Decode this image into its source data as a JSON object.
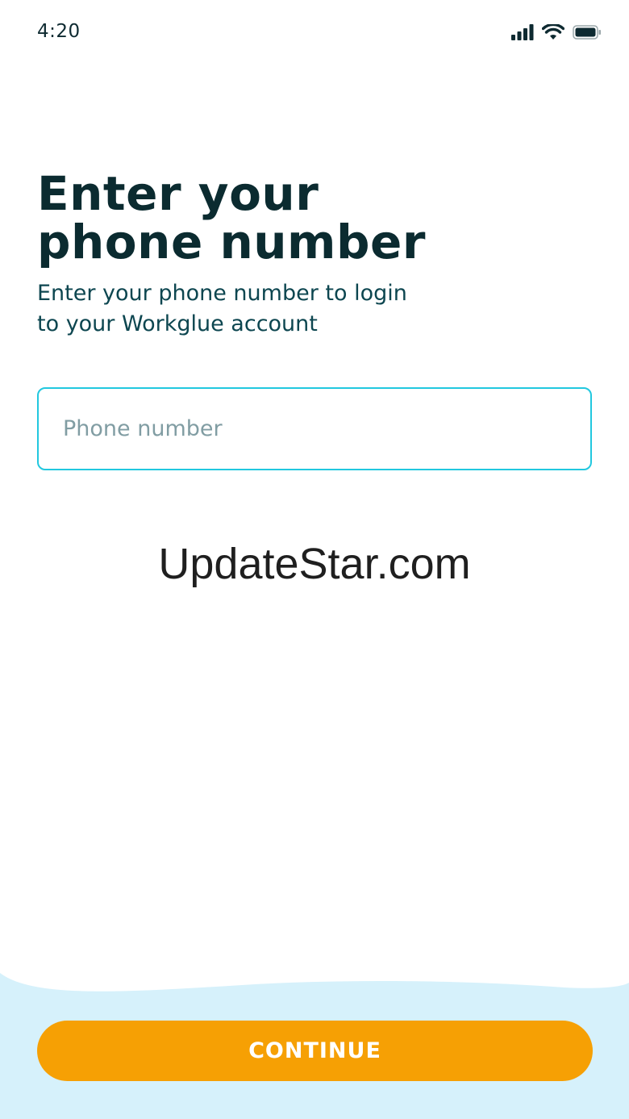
{
  "status_bar": {
    "time": "4:20",
    "icons": [
      "signal-icon",
      "wifi-icon",
      "battery-icon"
    ]
  },
  "header": {
    "title_line1": "Enter your",
    "title_line2": "phone number",
    "subtitle_line1": "Enter your phone number to login",
    "subtitle_line2": "to your Workglue account"
  },
  "form": {
    "phone_placeholder": "Phone number",
    "phone_value": ""
  },
  "watermark": {
    "text": "UpdateStar.com"
  },
  "footer": {
    "continue_label": "CONTINUE"
  },
  "colors": {
    "title": "#0b2b30",
    "subtitle": "#0d4650",
    "input_border": "#22c8df",
    "placeholder": "#819da3",
    "button": "#f6a004",
    "footer_bg": "#d6f1fb"
  }
}
